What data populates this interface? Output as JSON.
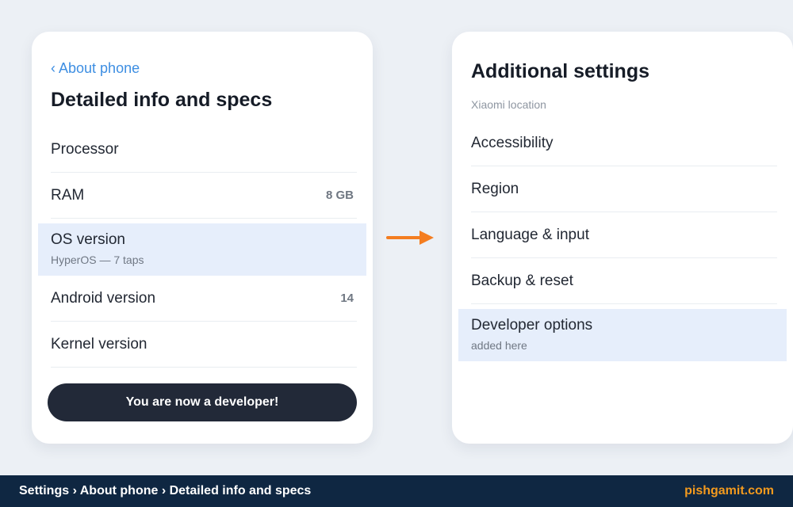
{
  "left_panel": {
    "back_link": "‹ About phone",
    "title": "Detailed info and specs",
    "rows": [
      {
        "label": "Processor",
        "value": ""
      },
      {
        "label": "RAM",
        "value": "8 GB"
      },
      {
        "label": "OS version",
        "sub": "HyperOS — 7 taps",
        "highlighted": true
      },
      {
        "label": "Android version",
        "value": "14"
      },
      {
        "label": "Kernel version",
        "value": ""
      }
    ],
    "toast_button": "You are now a developer!"
  },
  "arrow": {
    "icon": "arrow-right-icon",
    "color": "#f47d20"
  },
  "right_panel": {
    "title": "Additional settings",
    "subheader": "Xiaomi location",
    "rows": [
      {
        "label": "Accessibility"
      },
      {
        "label": "Region"
      },
      {
        "label": "Language & input"
      },
      {
        "label": "Backup & reset"
      },
      {
        "label": "Developer options",
        "sub": "added here",
        "highlighted": true
      }
    ]
  },
  "footer": {
    "breadcrumb": "Settings › About phone › Detailed info and specs",
    "brand": "pishgamit.com"
  },
  "colors": {
    "background": "#ecf0f5",
    "highlight": "#e6eefb",
    "link": "#3d8ee2",
    "button": "#222938",
    "footer": "#0f2742",
    "brand": "#f39a1e"
  }
}
